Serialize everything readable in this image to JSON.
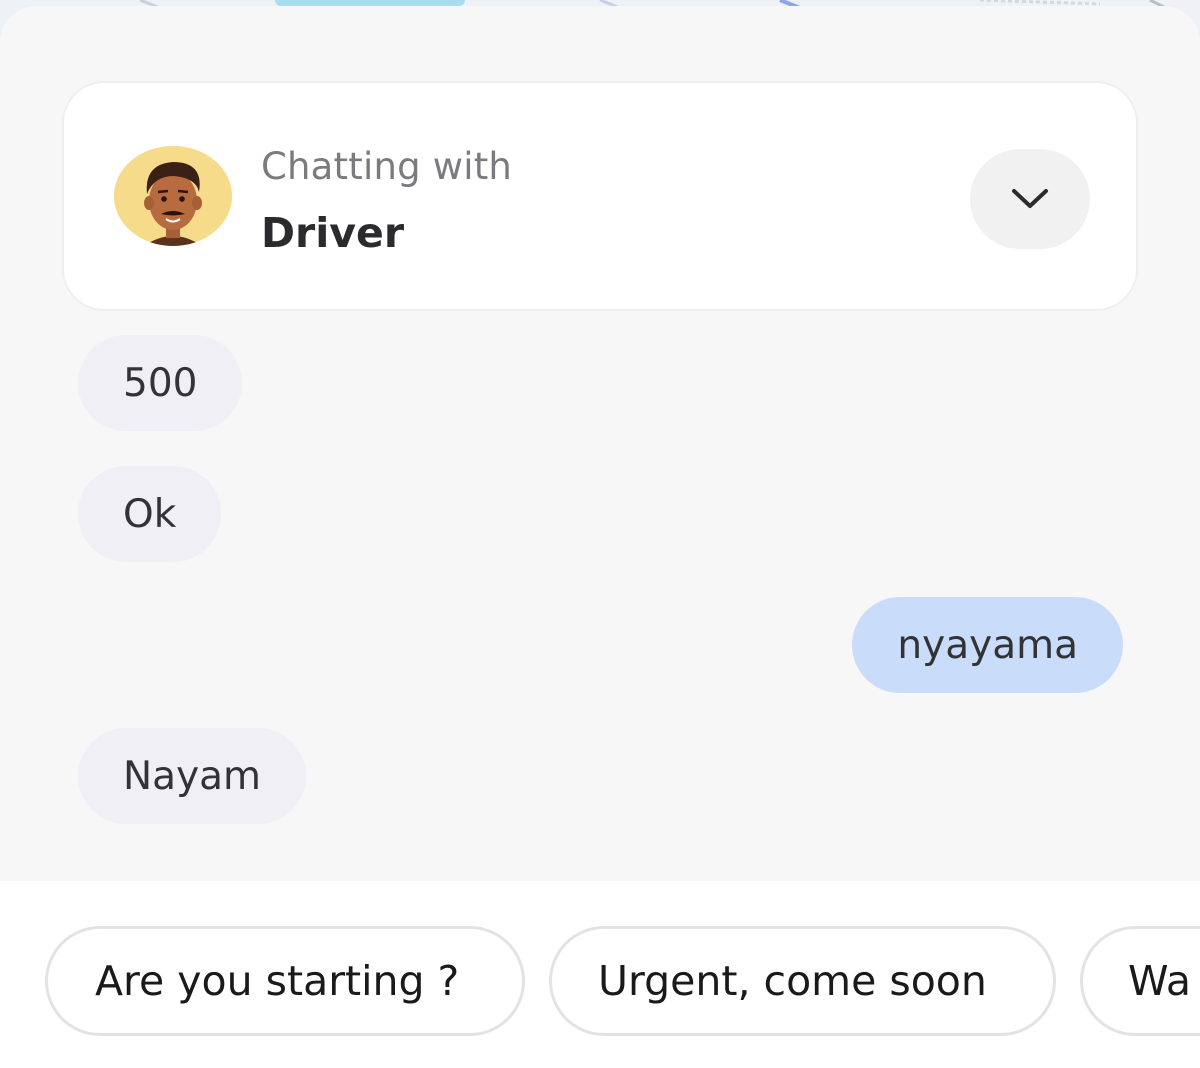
{
  "header": {
    "subtitle": "Chatting with",
    "title": "Driver",
    "avatar_icon": "driver-avatar",
    "collapse_icon": "chevron-down-icon"
  },
  "messages": [
    {
      "direction": "incoming",
      "text": "500"
    },
    {
      "direction": "incoming",
      "text": "Ok"
    },
    {
      "direction": "outgoing",
      "text": "nyayama"
    },
    {
      "direction": "incoming",
      "text": "Nayam"
    }
  ],
  "quick_replies": [
    {
      "label": "Are you starting ?"
    },
    {
      "label": "Urgent, come soon"
    },
    {
      "label": "Wa"
    }
  ],
  "colors": {
    "sheet_background": "#f7f7f8",
    "incoming_bubble": "#efeff5",
    "outgoing_bubble": "#c9dcfa",
    "avatar_background": "#f6dc8a"
  }
}
